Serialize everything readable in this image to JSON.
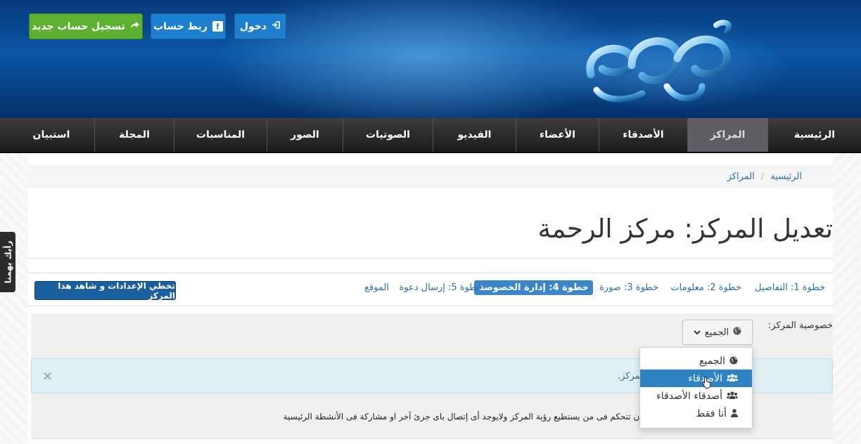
{
  "header": {
    "login_label": "دخول",
    "link_account_label": "ربط حساب",
    "register_label": "تسجيل حساب جديد"
  },
  "nav": {
    "items": [
      {
        "label": "الرئيسية"
      },
      {
        "label": "المراكز"
      },
      {
        "label": "الأصدقاء"
      },
      {
        "label": "الأعضاء"
      },
      {
        "label": "الفيديو"
      },
      {
        "label": "الصوتيات"
      },
      {
        "label": "الصور"
      },
      {
        "label": "المناسبات"
      },
      {
        "label": "المجلة"
      },
      {
        "label": "استبيان"
      }
    ],
    "active_index": 1
  },
  "breadcrumb": {
    "items": [
      "الرئيسية",
      "المراكز"
    ],
    "separator": "/"
  },
  "page": {
    "title": "تعديل المركز: مركز الرحمة"
  },
  "steps": {
    "items": [
      {
        "label": "خطوة 1: التفاصيل"
      },
      {
        "label": "خطوة 2: معلومات"
      },
      {
        "label": "خطوة 3: صورة"
      },
      {
        "label": "خطوة 4: إدارة الخصوصة"
      },
      {
        "label": "خطوة 5: إرسال دعوة"
      },
      {
        "label": "الموقع"
      }
    ],
    "active_index": 3,
    "skip_label": "تخطي الإعدادات و شاهد هذا المركز"
  },
  "privacy": {
    "label": "خصوصية المركز:",
    "selected": "الجميع",
    "options": [
      "الجميع",
      "الأصدقاء",
      "أصدقاء الأصدقاء",
      "أنا فقط"
    ],
    "highlighted_index": 1
  },
  "alert": {
    "text": "المركز.",
    "close": "×"
  },
  "help_text": "تستطيع ان تتحكم فى من يستطيع رؤية المركز ولايوجد أى إتصال باى جزئ آخر او مشاركة فى الأنشطة الرئيسية",
  "feedback_tab": "رأيك يهمنا",
  "colors": {
    "nav_bg": "#2a2a2a",
    "nav_active": "#5e5e64",
    "primary_blue": "#1e7fcf",
    "green": "#5cb130",
    "highlight": "#2f83c2",
    "alert_bg": "#dff0f5"
  }
}
